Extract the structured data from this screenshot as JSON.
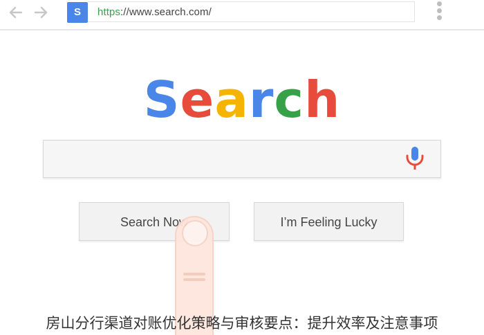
{
  "browser": {
    "back_icon": "arrow-left-icon",
    "forward_icon": "arrow-right-icon",
    "tab_letter": "S",
    "url_scheme": "https",
    "url_rest": "://www.search.com/",
    "menu_icon": "kebab-menu-icon"
  },
  "logo": {
    "letters": [
      "S",
      "e",
      "a",
      "r",
      "c",
      "h"
    ],
    "colors": [
      "#4a86e8",
      "#e64b3c",
      "#f4b400",
      "#4a86e8",
      "#37a14a",
      "#e64b3c"
    ]
  },
  "search": {
    "value": "",
    "mic_icon": "microphone-icon"
  },
  "buttons": {
    "search_now": "Search Now",
    "feeling_lucky": "I’m Feeling Lucky"
  },
  "caption": "房山分行渠道对账优化策略与审核要点：提升效率及注意事项"
}
